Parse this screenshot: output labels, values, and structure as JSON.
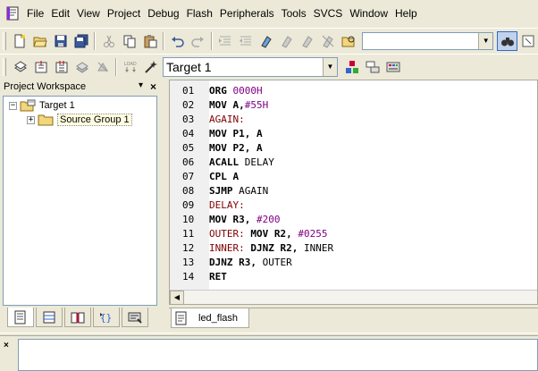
{
  "menu": {
    "items": [
      "File",
      "Edit",
      "View",
      "Project",
      "Debug",
      "Flash",
      "Peripherals",
      "Tools",
      "SVCS",
      "Window",
      "Help"
    ]
  },
  "toolbar": {
    "find_value": "",
    "target_value": "Target 1"
  },
  "workspace": {
    "title": "Project Workspace",
    "pin": "▾",
    "close": "×",
    "tree": {
      "target": "Target 1",
      "group": "Source Group 1",
      "target_expander": "−",
      "group_expander": "+"
    }
  },
  "editor": {
    "lines": [
      {
        "num": "01",
        "parts": [
          {
            "t": "ORG ",
            "c": "kw"
          },
          {
            "t": "0000H",
            "c": "num"
          }
        ]
      },
      {
        "num": "02",
        "parts": [
          {
            "t": "MOV A,",
            "c": "kw"
          },
          {
            "t": "#55H",
            "c": "num"
          }
        ]
      },
      {
        "num": "03",
        "parts": [
          {
            "t": "AGAIN:",
            "c": "lbl"
          }
        ]
      },
      {
        "num": "04",
        "parts": [
          {
            "t": "MOV P1, A",
            "c": "kw"
          }
        ]
      },
      {
        "num": "05",
        "parts": [
          {
            "t": "MOV P2, A",
            "c": "kw"
          }
        ]
      },
      {
        "num": "06",
        "parts": [
          {
            "t": "ACALL ",
            "c": "kw"
          },
          {
            "t": "DELAY",
            "c": "txt"
          }
        ]
      },
      {
        "num": "07",
        "parts": [
          {
            "t": "CPL A",
            "c": "kw"
          }
        ]
      },
      {
        "num": "08",
        "parts": [
          {
            "t": "SJMP ",
            "c": "kw"
          },
          {
            "t": "AGAIN",
            "c": "txt"
          }
        ]
      },
      {
        "num": "09",
        "parts": [
          {
            "t": "DELAY:",
            "c": "lbl"
          }
        ]
      },
      {
        "num": "10",
        "parts": [
          {
            "t": "MOV R3, ",
            "c": "kw"
          },
          {
            "t": "#200",
            "c": "num"
          }
        ]
      },
      {
        "num": "11",
        "parts": [
          {
            "t": "OUTER: ",
            "c": "lbl"
          },
          {
            "t": "MOV R2, ",
            "c": "kw"
          },
          {
            "t": "#0255",
            "c": "num"
          }
        ]
      },
      {
        "num": "12",
        "parts": [
          {
            "t": "INNER: ",
            "c": "lbl"
          },
          {
            "t": "DJNZ R2, ",
            "c": "kw"
          },
          {
            "t": "INNER",
            "c": "txt"
          }
        ]
      },
      {
        "num": "13",
        "parts": [
          {
            "t": "DJNZ R3, ",
            "c": "kw"
          },
          {
            "t": "OUTER",
            "c": "txt"
          }
        ]
      },
      {
        "num": "14",
        "parts": [
          {
            "t": "RET",
            "c": "kw"
          }
        ]
      }
    ],
    "file_tab": "led_flash"
  },
  "output": {
    "close": "×"
  },
  "colors": {
    "label": "#800000",
    "number": "#800080",
    "selection": "#316ac5"
  }
}
